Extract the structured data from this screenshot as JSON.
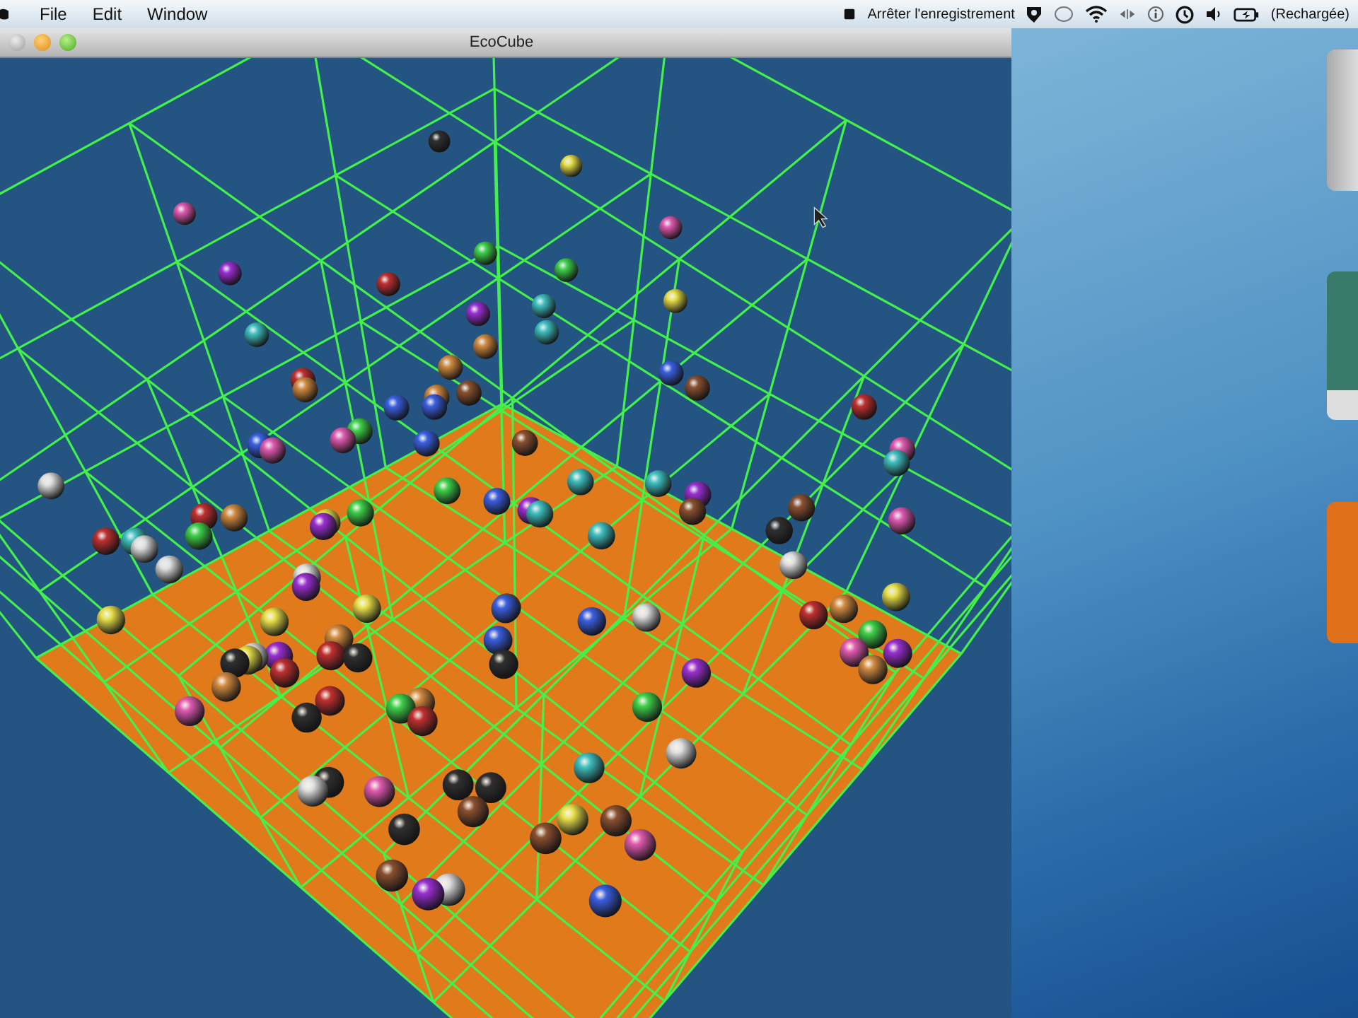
{
  "menu_bar": {
    "menus": [
      "File",
      "Edit",
      "Window"
    ],
    "recording_label": "Arrêter l'enregistrement",
    "battery_label": "(Rechargée)"
  },
  "window": {
    "title": "EcoCube"
  }
}
